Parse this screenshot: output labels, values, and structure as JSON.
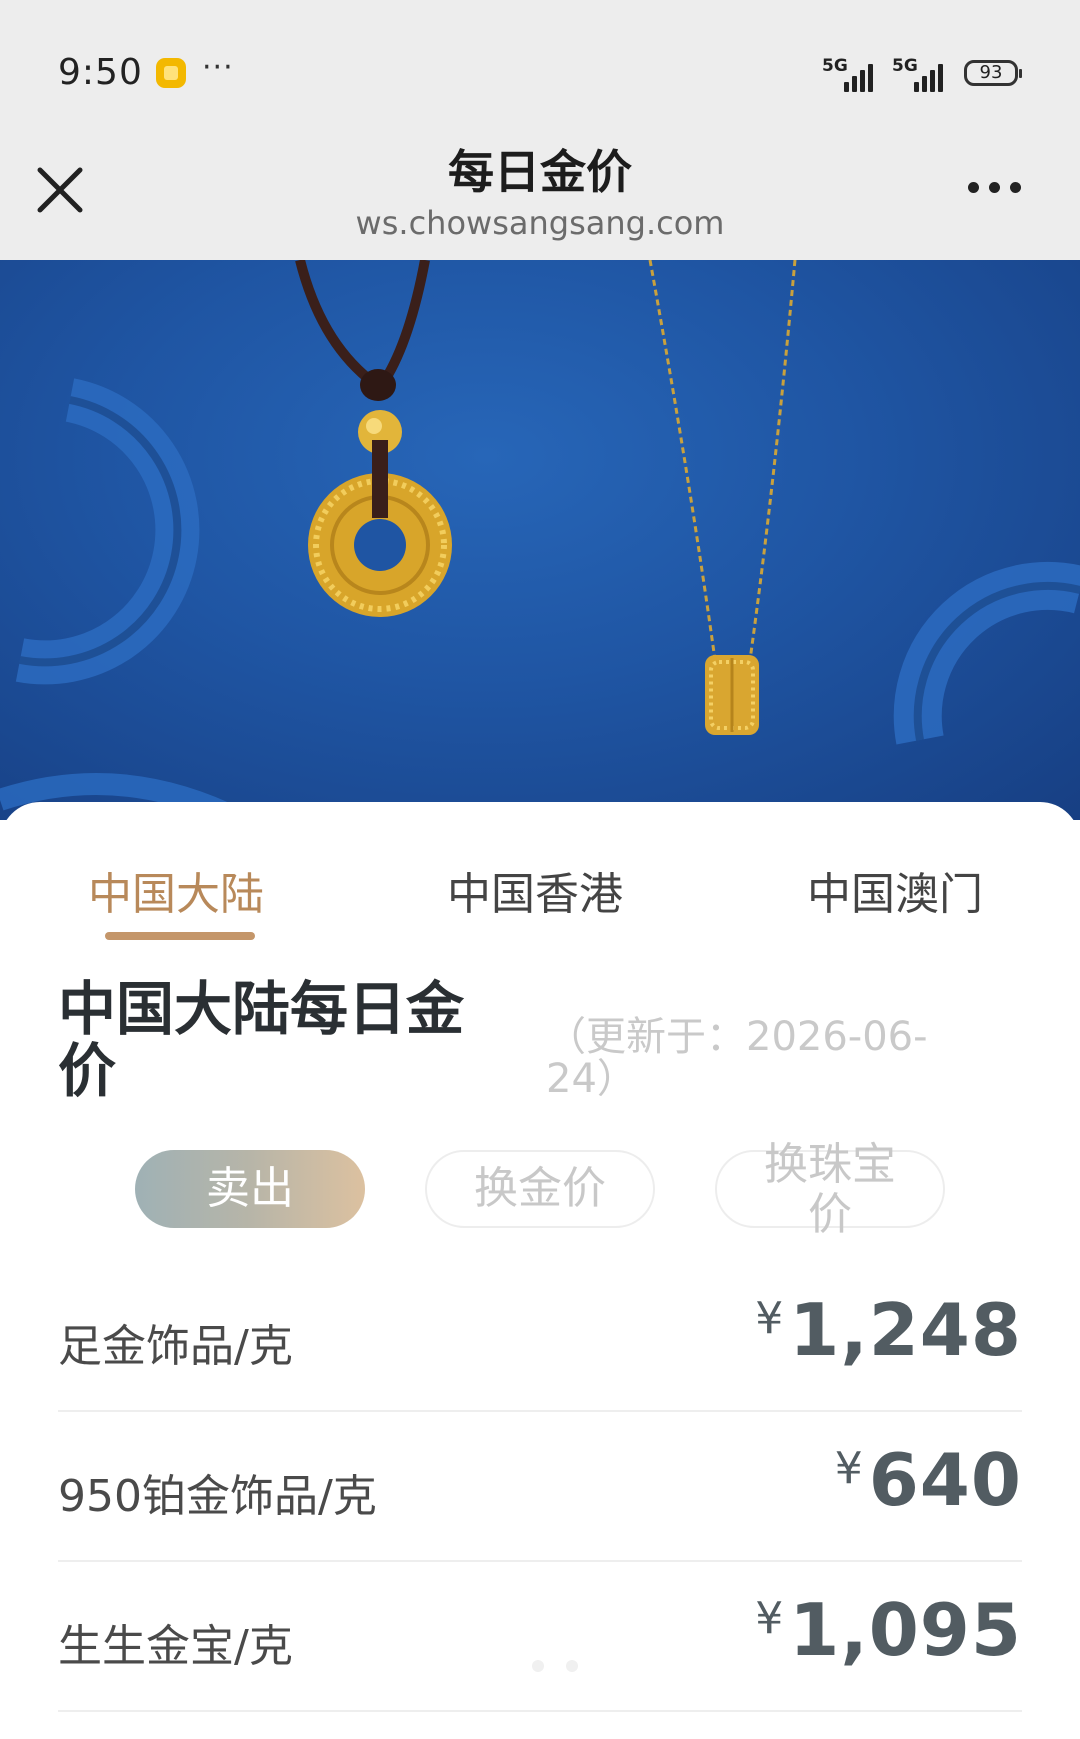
{
  "status_bar": {
    "time": "9:50",
    "app_icon": "notification-app-icon",
    "more": "···",
    "network_1": "5G",
    "network_2": "5G",
    "battery": "93"
  },
  "nav": {
    "title": "每日金价",
    "url": "ws.chowsangsang.com",
    "close_icon": "close-icon",
    "more_icon": "more-icon"
  },
  "banner": {
    "image": "gold-necklaces-banner"
  },
  "region_tabs": [
    {
      "label": "中国大陆",
      "active": true
    },
    {
      "label": "中国香港",
      "active": false
    },
    {
      "label": "中国澳门",
      "active": false
    }
  ],
  "section": {
    "title": "中国大陆每日金价",
    "update_note": "（更新于：2026-06-24）"
  },
  "price_types": [
    {
      "label": "卖出",
      "active": true
    },
    {
      "label": "换金价",
      "active": false
    },
    {
      "label": "换珠宝价",
      "active": false
    }
  ],
  "prices": [
    {
      "name": "足金饰品/克",
      "currency": "¥",
      "value": "1,248"
    },
    {
      "name": "950铂金饰品/克",
      "currency": "¥",
      "value": "640"
    },
    {
      "name": "生生金宝/克",
      "currency": "¥",
      "value": "1,095"
    }
  ],
  "colors": {
    "accent_gold": "#c4966a",
    "banner_blue": "#1f55a3",
    "price_text": "#525c62"
  }
}
